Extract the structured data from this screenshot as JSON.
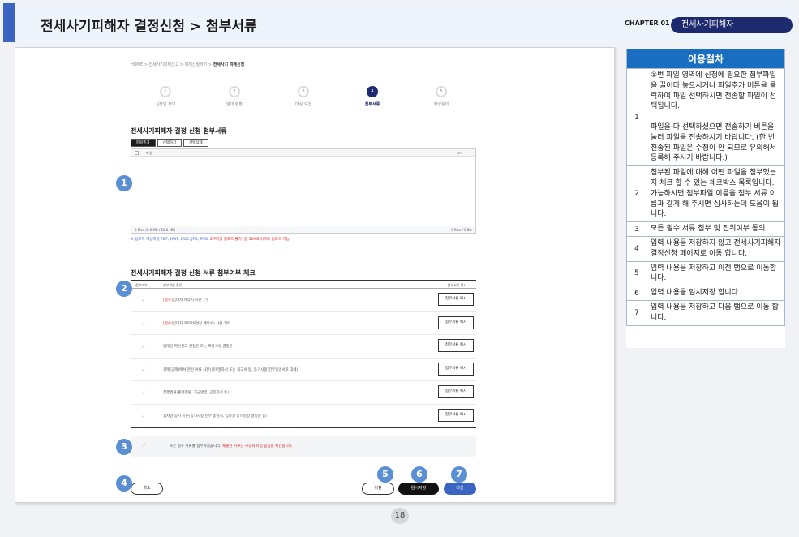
{
  "header": {
    "title": "전세사기피해자 결정신청 > 첨부서류",
    "chapter_label": "CHAPTER 01",
    "chapter_name": "전세사기피해자"
  },
  "breadcrumb": {
    "path": "HOME > 전세사기피해신고 > 피해신청하기 > ",
    "current": "전세사기 피해신청"
  },
  "stepper": {
    "steps": [
      {
        "num": "1",
        "label": "신청인 정보"
      },
      {
        "num": "2",
        "label": "임대 현황"
      },
      {
        "num": "3",
        "label": "대상 요건"
      },
      {
        "num": "4",
        "label": "첨부서류"
      },
      {
        "num": "5",
        "label": "작성실의"
      }
    ],
    "active_step": 4
  },
  "attach_section": {
    "title": "전세사기피해자 결정 신청 첨부서류",
    "tabs": [
      "파일추가",
      "선택하기",
      "선택삭제"
    ],
    "table_header_file": "파일",
    "table_header_size": "크기",
    "footer_left": "0 files (0.0 MB / 50.0 MB)",
    "footer_right": "0 files / 0 file",
    "notice_normal": "※ 업로드 가능파일 PDF, HWP, DOC, JPG, PNG, ",
    "notice_red": "ZIP파일 업로드 불가 (총 50MB 이하로 업로드 가능)"
  },
  "check_section": {
    "title": "전세사기피해자 결정 신청 서류 첨부여부 체크",
    "col_check": "첨부여부",
    "col_type": "첨부파일 종류",
    "col_sample": "첨부서류 예시",
    "sample_label": "첨부서류 예시",
    "rows": [
      {
        "req": "[필수]",
        "text": "임대차 계약서 사본 1부"
      },
      {
        "req": "[필수]",
        "text": "임대차 계약서(연장 계약서) 사본 1부"
      },
      {
        "req": "",
        "text": "임대인 확인신고 결정문 또는 확정서류 결정문"
      },
      {
        "req": "",
        "text": "경매(공매)에서 관련 서류 사본(경매절차서 또는 회고서 등, 등기사항 전부증명서로 대체)"
      },
      {
        "req": "",
        "text": "집행권원(판결정본, 지급명령, 공증증서 등)"
      },
      {
        "req": "",
        "text": "임차권 등기 서본(등기사항 전부 증명서, 임차권 등기명령 결정문 등)"
      }
    ],
    "agree_text": "모든 필수 서류를 첨부하였습니다. ",
    "agree_red": "제출된 서류는 사실과 다름 없음을 확인합니다."
  },
  "buttons": {
    "cancel": "취소",
    "prev": "이전",
    "temp_save": "임시저장",
    "next": "다음"
  },
  "badges": [
    "1",
    "2",
    "3",
    "4",
    "5",
    "6",
    "7"
  ],
  "side": {
    "title": "이용절차",
    "rows": [
      {
        "num": "1",
        "paras": [
          "①번 파일 영역에 신청에 필요한 첨부파일을 끌어다 놓으시거나 파일추가 버튼을 클릭하여 파일 선택하시면 전송할 파일이 선택됩니다.",
          "파일을 다 선택하셨으면 전송하기 버튼을 눌러 파일을 전송하시기 바랍니다. (한 번 전송된 파일은 수정이 안 되므로 유의해서 등록해 주시기 바랍니다.)"
        ]
      },
      {
        "num": "2",
        "paras": [
          "첨부된 파일에 대해 어떤 파일을 첨부했는지 체크 할 수 있는 체크박스 목록입니다.",
          "가능하시면 첨부파일 이름을 첨부 서류 이름과 같게 해 주시면 심사하는데 도움이 됩니다."
        ]
      },
      {
        "num": "3",
        "paras": [
          "모든 필수 서류 첨부 및 진위여부 동의"
        ]
      },
      {
        "num": "4",
        "paras": [
          "입력 내용을 저장하지 않고 전세사기피해자 결정신청 페이지로 이동 합니다."
        ]
      },
      {
        "num": "5",
        "paras": [
          "입력 내용을 저장하고 이전 탭으로 이동합니다."
        ]
      },
      {
        "num": "6",
        "paras": [
          "입력 내용을 임시저장 합니다."
        ]
      },
      {
        "num": "7",
        "paras": [
          "입력 내용을 저장하고 다음 탭으로 이동 합니다."
        ]
      }
    ]
  },
  "page_number": "18",
  "colors": {
    "accent": "#3b64c2",
    "navy": "#1e2a6e",
    "side_header": "#1a6ec2",
    "badge": "#5b8fd4",
    "required": "#dd2222"
  }
}
